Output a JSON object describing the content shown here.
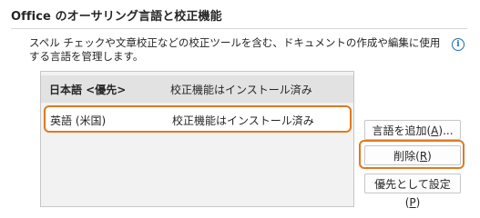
{
  "section": {
    "title": "Office のオーサリング言語と校正機能",
    "description": "スペル チェックや文章校正などの校正ツールを含む、ドキュメントの作成や編集に使用する言語を管理します。",
    "info_icon": "info-icon"
  },
  "languages": [
    {
      "name": "日本語 <優先>",
      "status": "校正機能はインストール済み",
      "is_default": true,
      "selected": false
    },
    {
      "name": "英語 (米国)",
      "status": "校正機能はインストール済み",
      "is_default": false,
      "selected": true
    }
  ],
  "buttons": {
    "add": {
      "label": "言語を追加(",
      "mnemonic": "A",
      "suffix": ")..."
    },
    "remove": {
      "label": "削除(",
      "mnemonic": "R",
      "suffix": ")"
    },
    "set_default": {
      "label": "優先として設定(",
      "mnemonic": "P",
      "suffix": ")"
    }
  },
  "colors": {
    "focus_outline": "#e07a1f",
    "info_icon": "#1f6ab8"
  }
}
